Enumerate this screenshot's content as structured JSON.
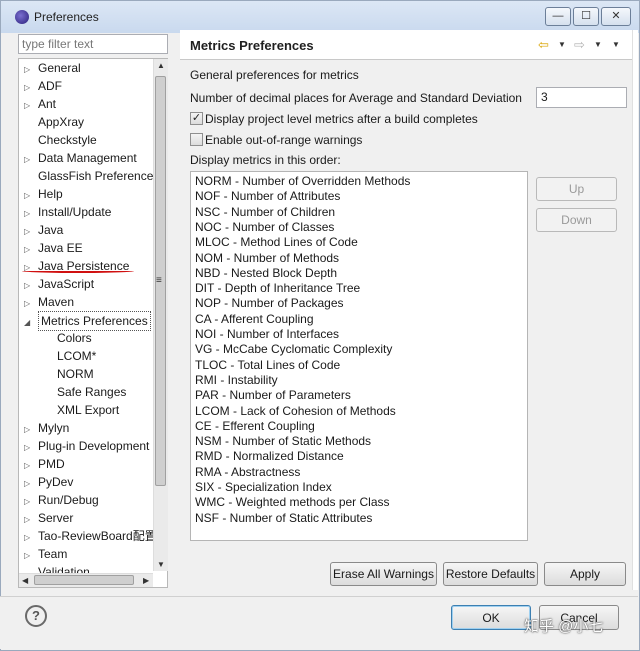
{
  "window": {
    "title": "Preferences"
  },
  "filter": {
    "placeholder": "type filter text"
  },
  "tree": {
    "items": [
      {
        "label": "General",
        "arrow": "▷",
        "level": 0
      },
      {
        "label": "ADF",
        "arrow": "▷",
        "level": 0
      },
      {
        "label": "Ant",
        "arrow": "▷",
        "level": 0
      },
      {
        "label": "AppXray",
        "arrow": "",
        "level": 0
      },
      {
        "label": "Checkstyle",
        "arrow": "",
        "level": 0
      },
      {
        "label": "Data Management",
        "arrow": "▷",
        "level": 0
      },
      {
        "label": "GlassFish Preferences",
        "arrow": "",
        "level": 0
      },
      {
        "label": "Help",
        "arrow": "▷",
        "level": 0
      },
      {
        "label": "Install/Update",
        "arrow": "▷",
        "level": 0
      },
      {
        "label": "Java",
        "arrow": "▷",
        "level": 0
      },
      {
        "label": "Java EE",
        "arrow": "▷",
        "level": 0
      },
      {
        "label": "Java Persistence",
        "arrow": "▷",
        "level": 0
      },
      {
        "label": "JavaScript",
        "arrow": "▷",
        "level": 0
      },
      {
        "label": "Maven",
        "arrow": "▷",
        "level": 0
      },
      {
        "label": "Metrics Preferences",
        "arrow": "◢",
        "level": 0,
        "selected": true
      },
      {
        "label": "Colors",
        "arrow": "",
        "level": 1
      },
      {
        "label": "LCOM*",
        "arrow": "",
        "level": 1
      },
      {
        "label": "NORM",
        "arrow": "",
        "level": 1
      },
      {
        "label": "Safe Ranges",
        "arrow": "",
        "level": 1
      },
      {
        "label": "XML Export",
        "arrow": "",
        "level": 1
      },
      {
        "label": "Mylyn",
        "arrow": "▷",
        "level": 0
      },
      {
        "label": "Plug-in Development",
        "arrow": "▷",
        "level": 0
      },
      {
        "label": "PMD",
        "arrow": "▷",
        "level": 0
      },
      {
        "label": "PyDev",
        "arrow": "▷",
        "level": 0
      },
      {
        "label": "Run/Debug",
        "arrow": "▷",
        "level": 0
      },
      {
        "label": "Server",
        "arrow": "▷",
        "level": 0
      },
      {
        "label": "Tao-ReviewBoard配置",
        "arrow": "▷",
        "level": 0
      },
      {
        "label": "Team",
        "arrow": "▷",
        "level": 0
      },
      {
        "label": "Validation",
        "arrow": "",
        "level": 0
      }
    ]
  },
  "page": {
    "title": "Metrics Preferences",
    "general_label": "General preferences for metrics",
    "decimal_label": "Number of decimal places for Average and Standard Deviation",
    "decimal_value": "3",
    "checkbox_project": {
      "label": "Display project level metrics after a build completes",
      "checked": true
    },
    "checkbox_range": {
      "label": "Enable out-of-range warnings",
      "checked": false
    },
    "order_label": "Display metrics in this order:",
    "metrics": [
      "NORM - Number of Overridden Methods",
      "NOF - Number of Attributes",
      "NSC - Number of Children",
      "NOC - Number of Classes",
      "MLOC - Method Lines of Code",
      "NOM - Number of Methods",
      "NBD - Nested Block Depth",
      "DIT - Depth of Inheritance Tree",
      "NOP - Number of Packages",
      "CA - Afferent Coupling",
      "NOI - Number of Interfaces",
      "VG - McCabe Cyclomatic Complexity",
      "TLOC - Total Lines of Code",
      "RMI - Instability",
      "PAR - Number of Parameters",
      "LCOM - Lack of Cohesion of Methods",
      "CE - Efferent Coupling",
      "NSM - Number of Static Methods",
      "RMD - Normalized Distance",
      "RMA - Abstractness",
      "SIX - Specialization Index",
      "WMC - Weighted methods per Class",
      "NSF - Number of Static Attributes"
    ],
    "up_label": "Up",
    "down_label": "Down",
    "erase_label": "Erase All Warnings",
    "restore_label": "Restore Defaults",
    "apply_label": "Apply"
  },
  "footer": {
    "ok_label": "OK",
    "cancel_label": "Cancel",
    "help_glyph": "?"
  },
  "watermark": "知乎 @小七",
  "icons": {
    "back": "back-arrow-icon",
    "forward": "forward-arrow-icon",
    "help": "help-icon"
  }
}
